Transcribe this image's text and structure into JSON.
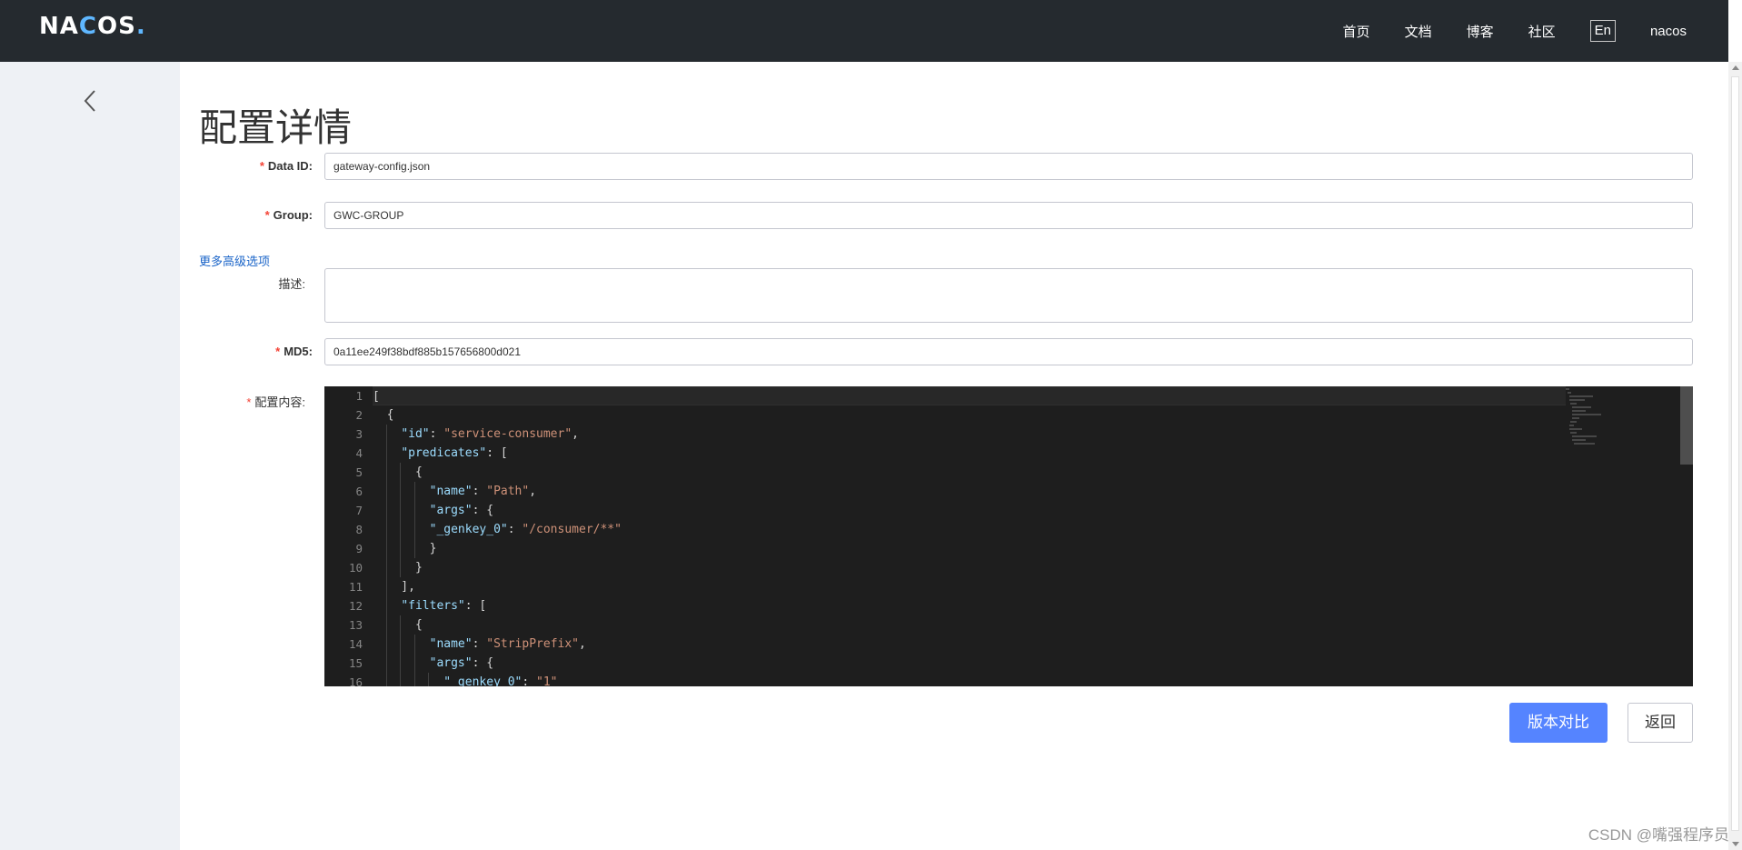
{
  "header": {
    "logo": "NACOS.",
    "nav": [
      "首页",
      "文档",
      "博客",
      "社区"
    ],
    "lang": "En",
    "user": "nacos"
  },
  "page": {
    "title": "配置详情"
  },
  "form": {
    "data_id": {
      "label": "Data ID:",
      "value": "gateway-config.json"
    },
    "group": {
      "label": "Group:",
      "value": "GWC-GROUP"
    },
    "more_options": "更多高级选项",
    "description": {
      "label": "描述:",
      "value": ""
    },
    "md5": {
      "label": "MD5:",
      "value": "0a11ee249f38bdf885b157656800d021"
    },
    "content": {
      "label": "配置内容:"
    }
  },
  "editor": {
    "line_numbers": [
      "1",
      "2",
      "3",
      "4",
      "5",
      "6",
      "7",
      "8",
      "9",
      "10",
      "11",
      "12",
      "13",
      "14",
      "15",
      "16"
    ],
    "lines": [
      "[",
      "  {",
      "    \"id\": \"service-consumer\",",
      "    \"predicates\": [",
      "      {",
      "        \"name\": \"Path\",",
      "        \"args\": {",
      "        \"_genkey_0\": \"/consumer/**\"",
      "        }",
      "      }",
      "    ],",
      "    \"filters\": [",
      "      {",
      "        \"name\": \"StripPrefix\",",
      "        \"args\": {",
      "          \"_genkey_0\": \"1\""
    ]
  },
  "buttons": {
    "compare": "版本对比",
    "back": "返回"
  },
  "watermark": "CSDN @嘴强程序员",
  "colors": {
    "topbar": "#252a2f",
    "sidebar": "#eef1f5",
    "primary": "#5584ff",
    "required": "#f44336",
    "link": "#1a64c8"
  }
}
